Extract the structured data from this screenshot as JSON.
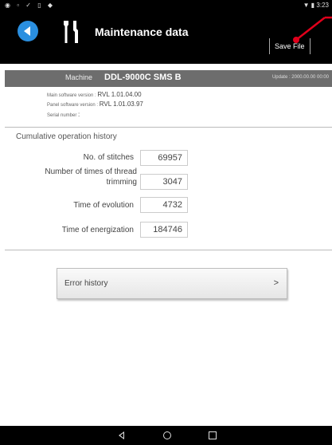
{
  "status_bar": {
    "left_icons": "◉ ▫ ✓ ▯ ◆",
    "time": "▼ ▮ 3:23"
  },
  "app_bar": {
    "title": "Maintenance data",
    "save_label": "Save File",
    "accent": "#2a8fe0",
    "callout_color": "#e0001b"
  },
  "machine": {
    "label": "Machine",
    "name": "DDL-9000C SMS B",
    "update": "Update : 2000.00.00 00:00"
  },
  "info": {
    "main_sw_label": "Main software version",
    "main_sw_value": "RVL 1.01.04.00",
    "panel_sw_label": "Panel software version",
    "panel_sw_value": "RVL 1.01.03.97",
    "serial_label": "Serial number"
  },
  "history": {
    "title": "Cumulative operation history",
    "rows": [
      {
        "label": "No. of stitches",
        "value": "69957"
      },
      {
        "label": "Number of times of thread trimming",
        "value": "3047"
      },
      {
        "label": "Time of evolution",
        "value": "4732"
      },
      {
        "label": "Time of energization",
        "value": "184746"
      }
    ]
  },
  "error_history": {
    "label": "Error history",
    "chevron": ">"
  }
}
